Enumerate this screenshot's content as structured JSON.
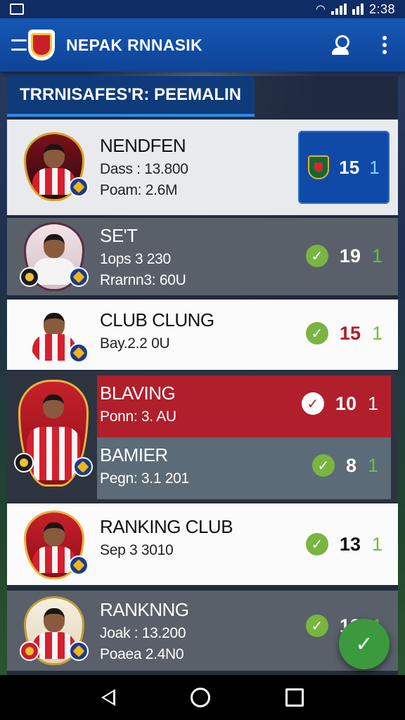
{
  "status_bar": {
    "time": "2:38"
  },
  "app_bar": {
    "title": "NEPAK RNNASIK"
  },
  "section": {
    "title": "TRRNISAFES'R: PEEMALIN"
  },
  "rows": [
    {
      "name": "NENDFEN",
      "line1": "Dass : 13.800",
      "line2": "Poam: 2.6M",
      "score_a": "15",
      "score_b": "1"
    },
    {
      "name": "SE'T",
      "line1": "1ops 3 230",
      "line2": "Rrarnn3: 60U",
      "score_a": "19",
      "score_b": "1"
    },
    {
      "name": "CLUB CLUNG",
      "line1": "Bay.2.2 0U",
      "score_a": "15",
      "score_b": "1"
    },
    {
      "name": "BLAVING",
      "line1": "Ponn: 3. AU",
      "score_a": "10",
      "score_b": "1"
    },
    {
      "name": "BAMIER",
      "line1": "Pegn: 3.1 201",
      "score_a": "8",
      "score_b": "1"
    },
    {
      "name": "RANKING CLUB",
      "line1": "Sep 3 3010",
      "score_a": "13",
      "score_b": "1"
    },
    {
      "name": "RANKNNG",
      "line1": "Joak : 13.200",
      "line2": "Poaea 2.4N0",
      "score_a": "13",
      "score_b": "1"
    }
  ],
  "icons": {
    "check": "✓",
    "fab": "✓"
  },
  "colors": {
    "app_bar": "#1657b4",
    "highlight_red": "#b01f2b",
    "accent_green": "#79b540",
    "score_box": "#0f4aa8"
  }
}
